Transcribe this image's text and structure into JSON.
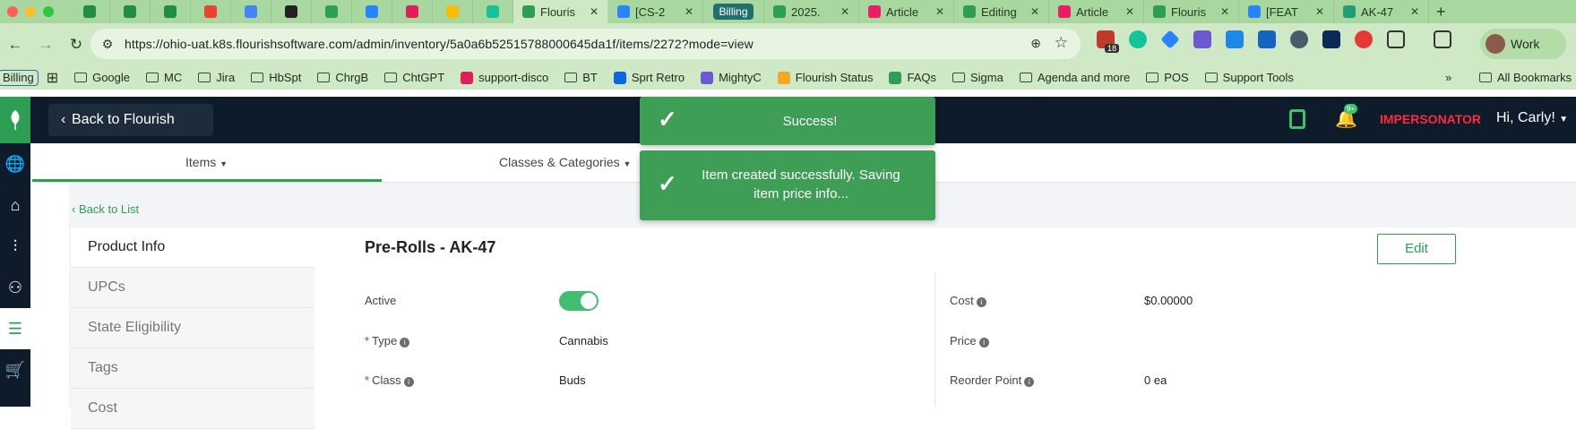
{
  "browser": {
    "tabs": [
      {
        "label": "",
        "icon": "flourish-icon",
        "color": "#1f8f3f",
        "size": "sq"
      },
      {
        "label": "",
        "icon": "flourish-icon",
        "color": "#1f8f3f",
        "size": "sq"
      },
      {
        "label": "",
        "icon": "flourish-icon",
        "color": "#1f8f3f",
        "size": "sq"
      },
      {
        "label": "",
        "icon": "gmail-icon",
        "color": "#ea4335",
        "size": "sq"
      },
      {
        "label": "",
        "icon": "calendar-icon",
        "color": "#4285f4",
        "size": "sq"
      },
      {
        "label": "",
        "icon": "chatgpt-icon",
        "color": "#222222",
        "size": "sq"
      },
      {
        "label": "",
        "icon": "leaf-icon",
        "color": "#2e9e54",
        "size": "sq"
      },
      {
        "label": "",
        "icon": "jira-icon",
        "color": "#2684ff",
        "size": "sq"
      },
      {
        "label": "",
        "icon": "slack-icon",
        "color": "#e01e5a",
        "size": "sq"
      },
      {
        "label": "",
        "icon": "drive-icon",
        "color": "#fbbc04",
        "size": "sq"
      },
      {
        "label": "",
        "icon": "grammarly-icon",
        "color": "#15c39a",
        "size": "sq"
      },
      {
        "label": "Flouris",
        "icon": "leaf-icon",
        "color": "#2e9e54",
        "size": "wide",
        "active": true
      },
      {
        "label": "[CS-2",
        "icon": "jira-icon",
        "color": "#2684ff",
        "size": "wide"
      },
      {
        "label": "Billing",
        "icon": "",
        "color": "#1f6f6f",
        "size": "billing"
      },
      {
        "label": "2025.",
        "icon": "leaf-icon",
        "color": "#2e9e54",
        "size": "wide"
      },
      {
        "label": "Article",
        "icon": "intercom-icon",
        "color": "#e91e63",
        "size": "wide"
      },
      {
        "label": "Editing",
        "icon": "leaf-icon",
        "color": "#2e9e54",
        "size": "wide"
      },
      {
        "label": "Article",
        "icon": "intercom-icon",
        "color": "#e91e63",
        "size": "wide"
      },
      {
        "label": "Flouris",
        "icon": "leaf-icon",
        "color": "#2e9e54",
        "size": "wide"
      },
      {
        "label": "[FEAT",
        "icon": "jira-icon",
        "color": "#2684ff",
        "size": "wide"
      },
      {
        "label": "AK-47",
        "icon": "cannabis-icon",
        "color": "#1f9e6f",
        "size": "wide"
      }
    ],
    "url": "https://ohio-uat.k8s.flourishsoftware.com/admin/inventory/5a0a6b52515788000645da1f/items/2272?mode=view",
    "ext_badge": "18",
    "profile_label": "Work",
    "bookmarks": [
      {
        "label": "Billing",
        "kind": "badge"
      },
      {
        "label": "",
        "kind": "apps"
      },
      {
        "label": "Google",
        "kind": "folder"
      },
      {
        "label": "MC",
        "kind": "folder"
      },
      {
        "label": "Jira",
        "kind": "folder"
      },
      {
        "label": "HbSpt",
        "kind": "folder"
      },
      {
        "label": "ChrgB",
        "kind": "folder"
      },
      {
        "label": "ChtGPT",
        "kind": "folder"
      },
      {
        "label": "support-disco",
        "kind": "slack"
      },
      {
        "label": "BT",
        "kind": "folder"
      },
      {
        "label": "Sprt Retro",
        "kind": "trello"
      },
      {
        "label": "MightyC",
        "kind": "dots"
      },
      {
        "label": "Flourish Status",
        "kind": "status"
      },
      {
        "label": "FAQs",
        "kind": "leaf"
      },
      {
        "label": "Sigma",
        "kind": "folder"
      },
      {
        "label": "Agenda and more",
        "kind": "folder"
      },
      {
        "label": "POS",
        "kind": "folder"
      },
      {
        "label": "Support Tools",
        "kind": "folder"
      }
    ],
    "bookmarks_overflow": "»",
    "all_bookmarks": "All Bookmarks"
  },
  "app": {
    "back_button": "Back to Flourish",
    "impersonator": "IMPERSONATOR",
    "greeting": "Hi, Carly!",
    "bell_badge": "9+",
    "subnav": {
      "items": "Items",
      "classes": "Classes & Categories"
    },
    "back_to_list": "Back to List",
    "left_nav": [
      "Product Info",
      "UPCs",
      "State Eligibility",
      "Tags",
      "Cost"
    ],
    "title": "Pre-Rolls - AK-47",
    "edit": "Edit",
    "fields_left": [
      {
        "label": "Active",
        "required": false,
        "info": false,
        "value": ""
      },
      {
        "label": "Type",
        "required": true,
        "info": true,
        "value": "Cannabis"
      },
      {
        "label": "Class",
        "required": true,
        "info": true,
        "value": "Buds"
      }
    ],
    "active_toggle": true,
    "fields_right": [
      {
        "label": "Cost",
        "info": true,
        "value": "$0.00000"
      },
      {
        "label": "Price",
        "info": true,
        "value": ""
      },
      {
        "label": "Reorder Point",
        "info": true,
        "value": "0 ea"
      }
    ],
    "toasts": [
      {
        "message": "Success!"
      },
      {
        "message": "Item created successfully. Saving item price info..."
      }
    ]
  }
}
